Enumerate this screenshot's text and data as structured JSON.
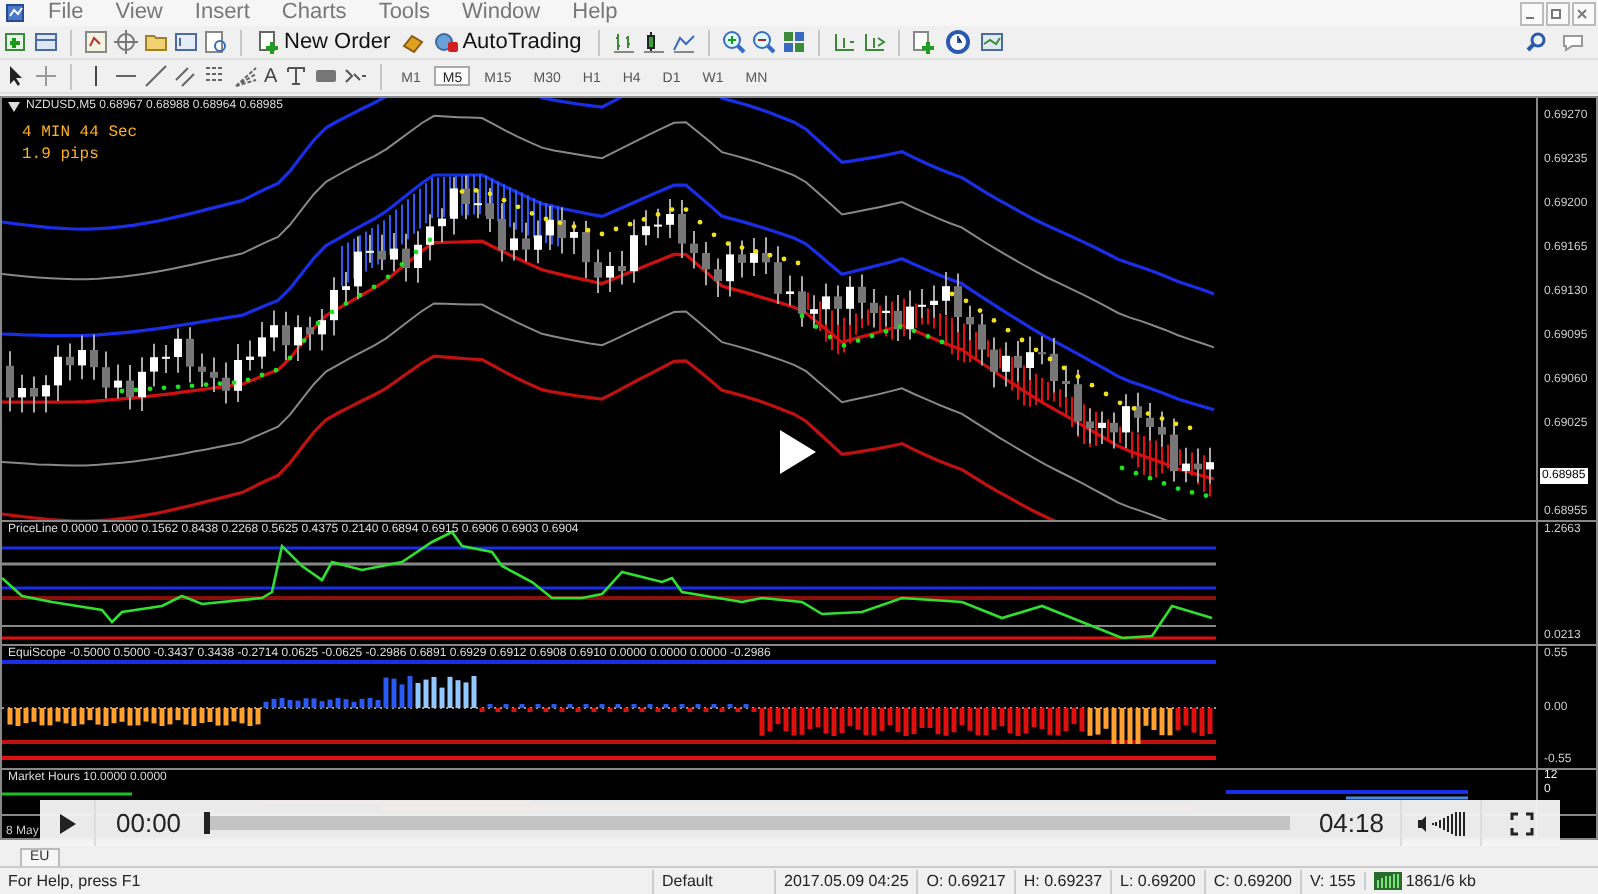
{
  "menu": [
    "File",
    "View",
    "Insert",
    "Charts",
    "Tools",
    "Window",
    "Help"
  ],
  "toolbar": {
    "new_order": "New Order",
    "auto_trading": "AutoTrading"
  },
  "draw_tools": {
    "text_tool": "A"
  },
  "timeframes": [
    {
      "label": "M1",
      "selected": false
    },
    {
      "label": "M5",
      "selected": true
    },
    {
      "label": "M15",
      "selected": false
    },
    {
      "label": "M30",
      "selected": false
    },
    {
      "label": "H1",
      "selected": false
    },
    {
      "label": "H4",
      "selected": false
    },
    {
      "label": "D1",
      "selected": false
    },
    {
      "label": "W1",
      "selected": false
    },
    {
      "label": "MN",
      "selected": false
    }
  ],
  "chart": {
    "symbol_info": "NZDUSD,M5  0.68967 0.68988 0.68964 0.68985",
    "timer": "4 MIN 44 Sec",
    "spread": "1.9 pips",
    "price_axis": [
      "0.69270",
      "0.69235",
      "0.69200",
      "0.69165",
      "0.69130",
      "0.69095",
      "0.69060",
      "0.69025",
      "0.68955"
    ],
    "current_price": "0.68985"
  },
  "indicators": [
    {
      "kind": "priceline",
      "label": "PriceLine 0.0000 1.0000 0.1562 0.8438 0.2268 0.5625 0.4375 0.2140 0.6894 0.6915 0.6906 0.6903 0.6904",
      "axis": [
        "1.2663",
        "0.0213"
      ]
    },
    {
      "kind": "equiscope",
      "label": "EquiScope -0.5000 0.5000 -0.3437 0.3438 -0.2714 0.0625 -0.0625 -0.2986 0.6891 0.6929 0.6912 0.6908 0.6910 0.0000 0.0000 0.0000 -0.2986",
      "axis": [
        "0.55",
        "0.00",
        "-0.55"
      ]
    },
    {
      "kind": "market_hours",
      "label": "Market Hours 10.0000 0.0000",
      "axis": [
        "12",
        "0"
      ]
    }
  ],
  "time_axis": [
    "8 May"
  ],
  "terminal_tabs": [
    "EU"
  ],
  "video": {
    "elapsed": "00:00",
    "duration": "04:18",
    "progress": {
      "level": 0.0
    }
  },
  "status_bar": {
    "help": "For Help, press F1",
    "profile": "Default",
    "time": "2017.05.09 04:25",
    "open": "O: 0.69217",
    "high": "H: 0.69237",
    "low": "L: 0.69200",
    "close": "C: 0.69200",
    "volume": "V: 155",
    "traffic": "1861/6 kb"
  }
}
